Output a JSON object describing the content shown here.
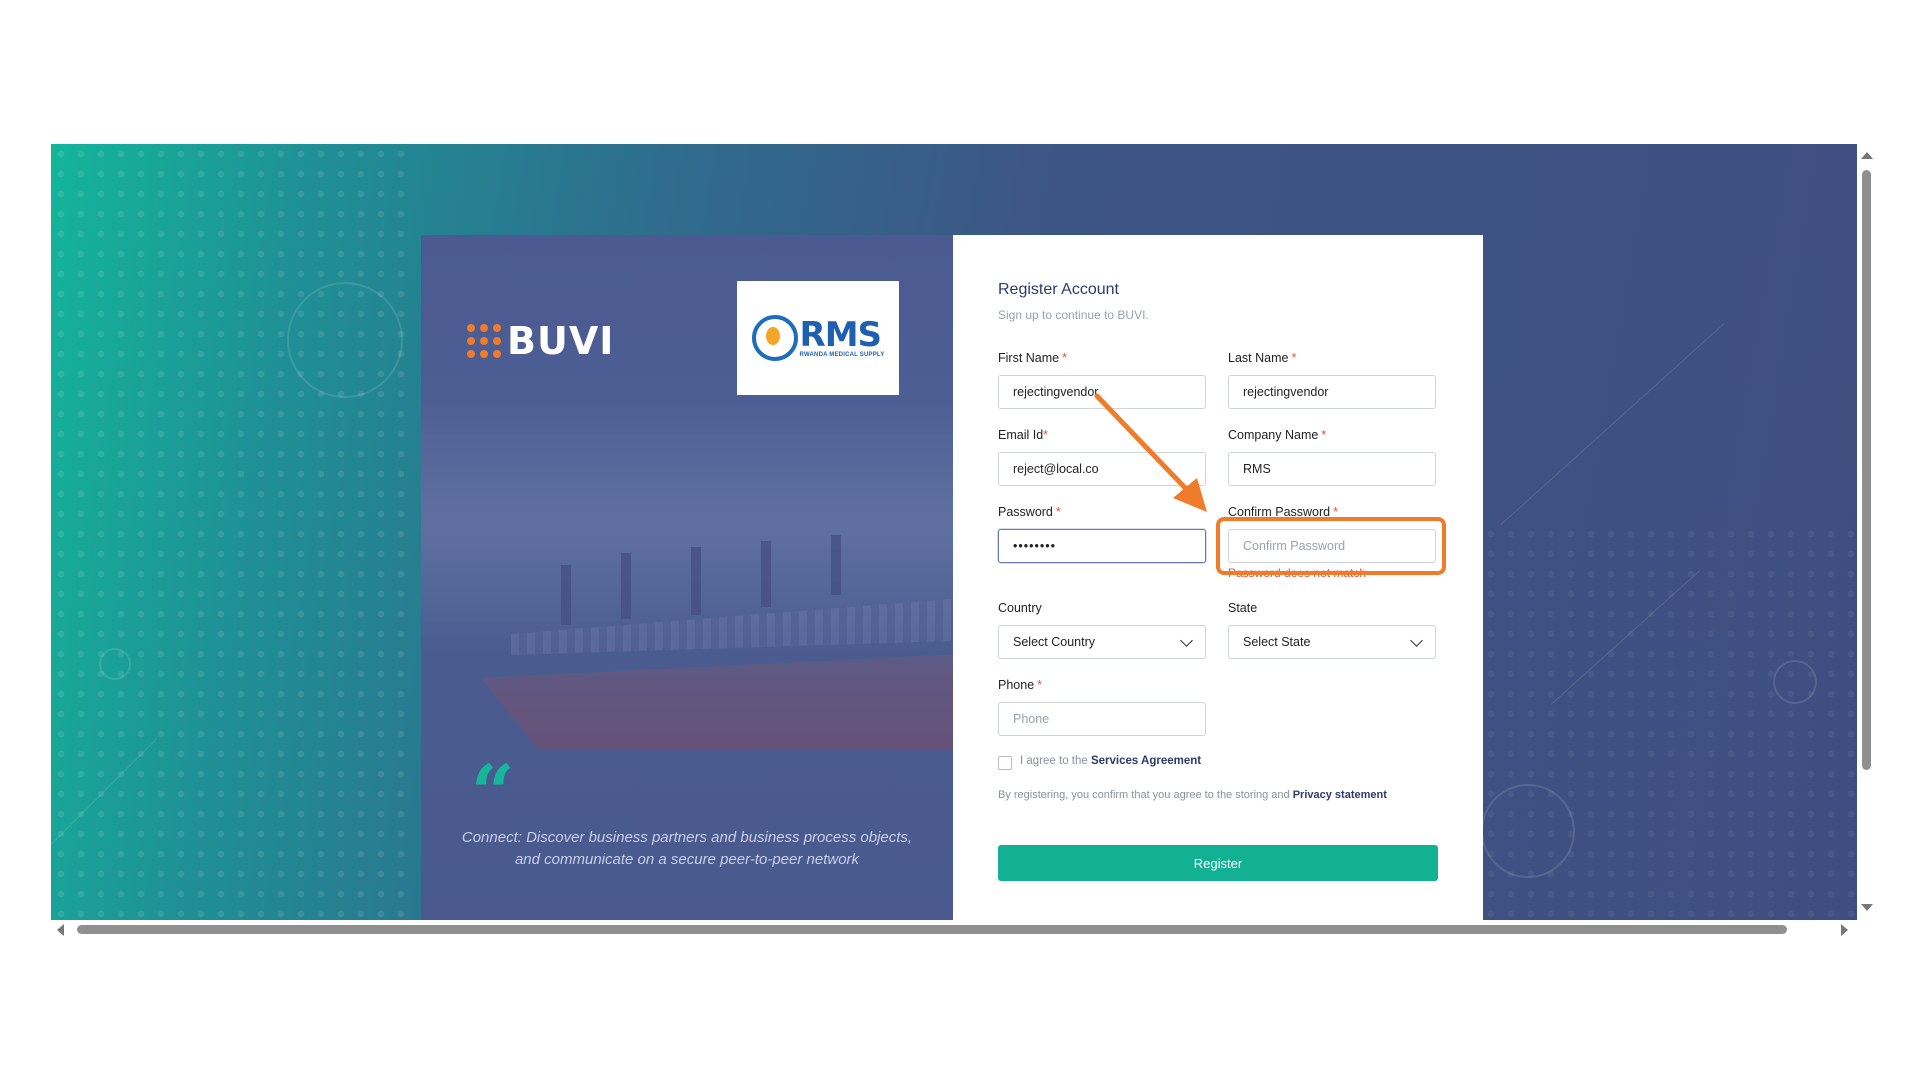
{
  "brand": {
    "buvi_logo": "BUVI",
    "partner_logo": {
      "name": "RMS",
      "subtitle": "RWANDA MEDICAL SUPPLY"
    }
  },
  "quote": {
    "mark": "“",
    "text": "Connect: Discover business partners and business process objects, and communicate on a secure peer-to-peer network"
  },
  "form": {
    "title": "Register Account",
    "subtitle": "Sign up to continue to BUVI.",
    "required_marker": "*",
    "first_name": {
      "label": "First Name",
      "value": "rejectingvendor"
    },
    "last_name": {
      "label": "Last Name",
      "value": "rejectingvendor"
    },
    "email": {
      "label": "Email Id",
      "value": "reject@local.co"
    },
    "company": {
      "label": "Company Name",
      "value": "RMS"
    },
    "password": {
      "label": "Password",
      "value": "••••••••"
    },
    "confirm_password": {
      "label": "Confirm Password",
      "value": "",
      "placeholder": "Confirm Password",
      "error": "Password does not match"
    },
    "country": {
      "label": "Country",
      "value": "Select Country"
    },
    "state": {
      "label": "State",
      "value": "Select State"
    },
    "phone": {
      "label": "Phone",
      "value": "",
      "placeholder": "Phone"
    },
    "agreement": {
      "prefix": "I agree to the ",
      "link": "Services Agreement",
      "checked": false
    },
    "consent": {
      "text": "By registering, you confirm that you agree to the storing and ",
      "link": "Privacy statement"
    },
    "register_label": "Register"
  },
  "colors": {
    "accent": "#12b193",
    "annotation": "#f07b2a",
    "error": "#e5533c",
    "heading": "#2d3b6b"
  }
}
